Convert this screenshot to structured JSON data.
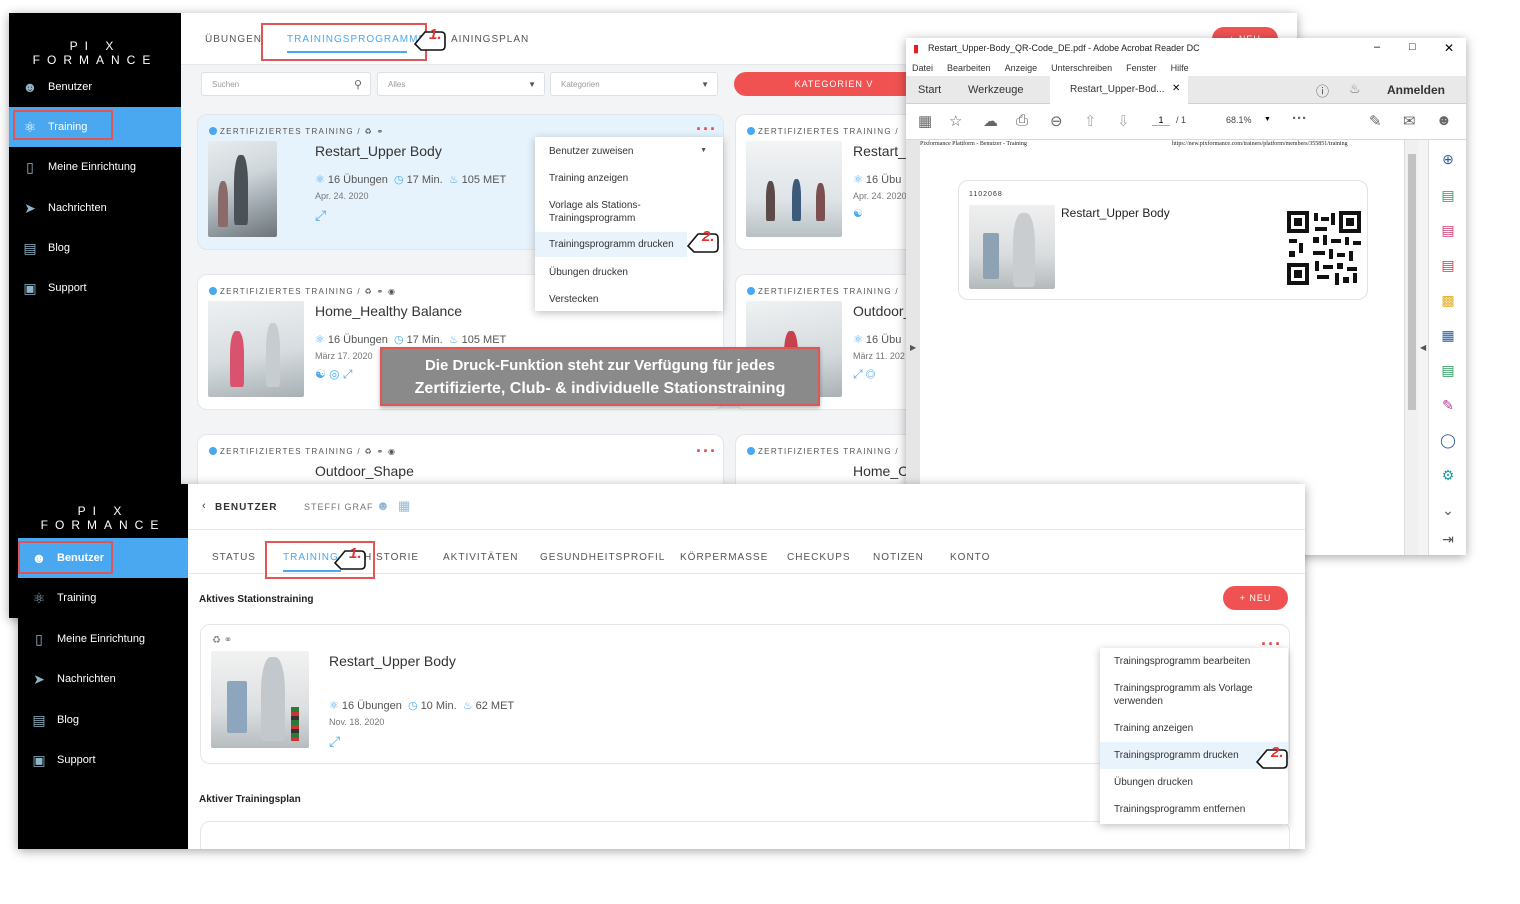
{
  "brand": "PI X FORMANCE",
  "top_window": {
    "sidebar": [
      {
        "label": "Benutzer",
        "icon": "users-icon"
      },
      {
        "label": "Training",
        "icon": "training-icon"
      },
      {
        "label": "Meine Einrichtung",
        "icon": "building-icon"
      },
      {
        "label": "Nachrichten",
        "icon": "send-icon"
      },
      {
        "label": "Blog",
        "icon": "chat-icon"
      },
      {
        "label": "Support",
        "icon": "support-icon"
      }
    ],
    "tabs": [
      "ÜBUNGEN",
      "TRAININGSPROGRAMME",
      "AININGSPLAN"
    ],
    "new_button": "+ NEU",
    "search_placeholder": "Suchen",
    "filter_all": "Alles",
    "filter_categories": "Kategorien",
    "categories_button": "KATEGORIEN V",
    "cert_label": "ZERTIFIZIERTES TRAINING /",
    "cards": [
      {
        "title": "Restart_Upper Body",
        "exercises": "16 Übungen",
        "duration": "17 Min.",
        "met": "105 MET",
        "date": "Apr. 24. 2020"
      },
      {
        "title": "Restart_I",
        "exercises": "16 Übu",
        "date": "Apr. 24. 2020"
      },
      {
        "title": "Home_Healthy Balance",
        "exercises": "16 Übungen",
        "duration": "17 Min.",
        "met": "105 MET",
        "date": "März 17. 2020"
      },
      {
        "title": "Outdoor_",
        "exercises": "16 Übu",
        "date": "März 11. 202"
      },
      {
        "title": "Outdoor_Shape"
      },
      {
        "title": "Home_C"
      }
    ],
    "context_menu": [
      "Benutzer zuweisen",
      "Training anzeigen",
      "Vorlage als Stations-",
      "Trainingsprogramm",
      "Trainingsprogramm drucken",
      "Übungen drucken",
      "Verstecken"
    ],
    "step1": "1.",
    "step2": "2."
  },
  "callout": {
    "line1": "Die Druck-Funktion steht zur Verfügung für jedes",
    "line2": "Zertifizierte, Club- &  individuelle Stationstraining"
  },
  "acrobat": {
    "title": "Restart_Upper-Body_QR-Code_DE.pdf - Adobe Acrobat Reader DC",
    "menu": [
      "Datei",
      "Bearbeiten",
      "Anzeige",
      "Unterschreiben",
      "Fenster",
      "Hilfe"
    ],
    "tab_start": "Start",
    "tab_tools": "Werkzeuge",
    "tab_doc": "Restart_Upper-Bod...",
    "sign_in": "Anmelden",
    "page_current": "1",
    "page_total": "/ 1",
    "zoom": "68.1%",
    "pdf_header_left": "Pixformance Plattform - Benutzer - Training",
    "pdf_header_right": "https://new.pixformance.com/trainers/platform/members/355851/training",
    "pdf_code": "1102068",
    "pdf_title": "Restart_Upper Body"
  },
  "bottom_window": {
    "sidebar": [
      {
        "label": "Benutzer",
        "icon": "users-icon"
      },
      {
        "label": "Training",
        "icon": "training-icon"
      },
      {
        "label": "Meine Einrichtung",
        "icon": "building-icon"
      },
      {
        "label": "Nachrichten",
        "icon": "send-icon"
      },
      {
        "label": "Blog",
        "icon": "chat-icon"
      },
      {
        "label": "Support",
        "icon": "support-icon"
      }
    ],
    "breadcrumb_back": "BENUTZER",
    "user_name": "STEFFI GRAF",
    "tabs": [
      "STATUS",
      "TRAINING",
      "HISTORIE",
      "AKTIVITÄTEN",
      "GESUNDHEITSPROFIL",
      "KÖRPERMASSE",
      "CHECKUPS",
      "NOTIZEN",
      "KONTO"
    ],
    "section_active_station": "Aktives Stationstraining",
    "new_button": "+ NEU",
    "card": {
      "title": "Restart_Upper Body",
      "exercises": "16 Übungen",
      "duration": "10 Min.",
      "met": "62 MET",
      "date": "Nov. 18. 2020"
    },
    "context_menu": [
      "Trainingsprogramm bearbeiten",
      "Trainingsprogramm als Vorlage",
      "verwenden",
      "Training anzeigen",
      "Trainingsprogramm drucken",
      "Übungen drucken",
      "Trainingsprogramm entfernen"
    ],
    "section_active_plan": "Aktiver Trainingsplan",
    "step1": "1.",
    "step2": "2."
  },
  "colors": {
    "accent": "#4aa8f0",
    "red": "#f05252",
    "sidebar": "#000000",
    "highlight": "#e25555"
  }
}
